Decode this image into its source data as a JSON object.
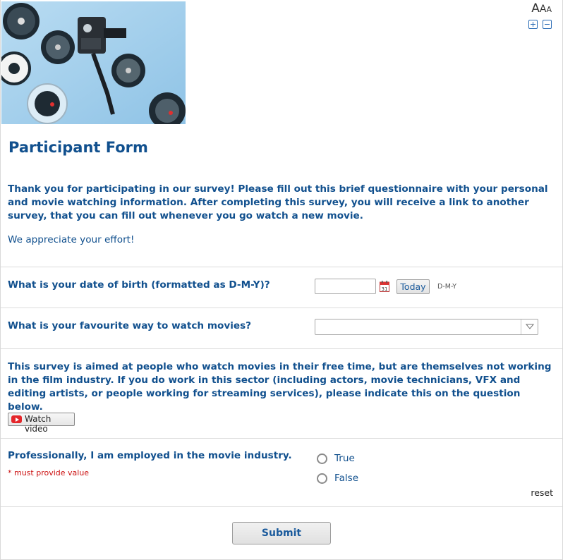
{
  "text_size": {
    "large": "A",
    "medium": "A",
    "small": "A"
  },
  "form": {
    "title": "Participant Form",
    "intro_bold": "Thank you for participating in our survey! Please fill out this brief questionnaire with your personal and movie watching information. After completing this survey, you will receive a link to another survey, that you can fill out whenever you go watch a new movie.",
    "intro_plain": "We appreciate your effort!"
  },
  "questions": {
    "dob": {
      "label": "What is your date of birth (formatted as D-M-Y)?",
      "value": "",
      "calendar_day": "31",
      "today_label": "Today",
      "format_hint": "D-M-Y"
    },
    "watch_way": {
      "label": "What is your favourite way to watch movies?",
      "selected": ""
    },
    "industry_info": "This survey is aimed at people who watch movies in their free time, but are themselves not working in the film industry. If you do work in this sector (including actors, movie technicians, VFX and editing artists, or people working for streaming services), please indicate this on the question below.",
    "video_button": "Watch video",
    "employed": {
      "label": "Professionally, I am employed in the movie industry.",
      "required_note": "* must provide value",
      "options": [
        "True",
        "False"
      ],
      "reset_label": "reset"
    }
  },
  "submit_label": "Submit",
  "colors": {
    "primary_text": "#11508e",
    "required": "#cc1111",
    "divider": "#dcdcdc",
    "icon_blue": "#2a6cb5"
  }
}
